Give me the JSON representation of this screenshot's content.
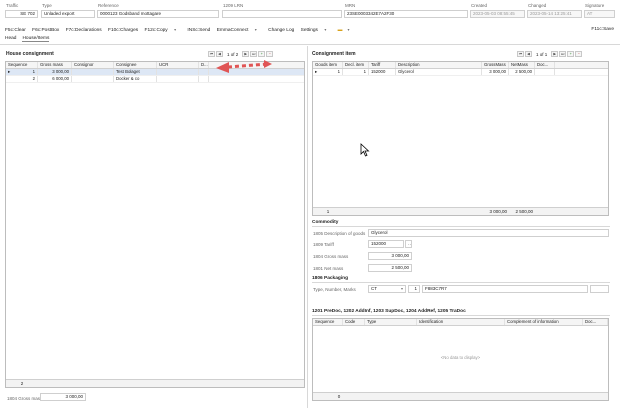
{
  "header": {
    "labels": {
      "traffic": "Traffic",
      "type": "Type",
      "reference": "Reference",
      "lrn": "1209 LRN",
      "mrn": "MRN",
      "created": "Created",
      "changed": "Changed",
      "signature": "Signature"
    },
    "values": {
      "traffic": "SE 702",
      "type": "Unladed export",
      "reference": "0000123 Godsband mottagare",
      "lrn": "",
      "mrn": "23SE0003342E7A2F30",
      "created": "2023-05-03 08:55:45",
      "changed": "2023-05-14 13:25:41",
      "signature": "AT"
    }
  },
  "toolbar": {
    "items": [
      "F5c:Clear",
      "F6c:PostBox",
      "F7c:Declarations",
      "F10c:Charges",
      "F12c:Copy",
      "INSc:Send",
      "EmmaConnect",
      "Change Log",
      "Settings"
    ],
    "save": "F11c:Save"
  },
  "tabs": [
    "Head",
    "House/Items"
  ],
  "house_consignment": {
    "title": "House consignment",
    "page_info": "1 of 2",
    "columns": [
      "Sequence",
      "Gross mass",
      "Consignor",
      "Consignee",
      "UCR",
      "D..."
    ],
    "rows": [
      {
        "sequence": "1",
        "gross_mass": "3 000,00",
        "consignor": "",
        "consignee": "Test Bolaget",
        "ucr": "",
        "d": ""
      },
      {
        "sequence": "2",
        "gross_mass": "6 000,00",
        "consignor": "",
        "consignee": "Docker & co",
        "ucr": "",
        "d": ""
      }
    ],
    "footer_count": "2",
    "gross_mass_label": "1804 Gross mass",
    "gross_mass_value": "3 000,00"
  },
  "consignment_item": {
    "title": "Consignment item",
    "page_info": "1 of 1",
    "columns": [
      "Goods item",
      "Decl. item",
      "Tariff",
      "Description",
      "GrossMass",
      "NetMass",
      "Doc..."
    ],
    "rows": [
      {
        "goods_item": "1",
        "decl_item": "1",
        "tariff": "152000",
        "description": "Glycerol",
        "gross": "3 000,00",
        "net": "2 500,00",
        "doc": ""
      }
    ],
    "footer": {
      "count": "1",
      "gross": "3 000,00",
      "net": "2 500,00"
    }
  },
  "commodity": {
    "title": "Commodity",
    "description_label": "1805 Description of goods",
    "description_value": "Glycerol",
    "tariff_label": "1809 Tariff",
    "tariff_value": "152000",
    "gross_label": "1804 Gross mass",
    "gross_value": "3 000,00",
    "net_label": "1801 Net mass",
    "net_value": "2 500,00"
  },
  "packaging": {
    "title": "1806 Packaging",
    "label": "Type, Number, Marks",
    "type": "CT",
    "number": "1",
    "marks": "F883C7R7"
  },
  "docs": {
    "title": "1201 PreDoc, 1202 AddInf, 1203 SupDoc, 1204 AddRef, 1205 TraDoc",
    "columns": [
      "Sequence",
      "Code",
      "Type",
      "Identification",
      "Complement of information",
      "Doc..."
    ],
    "empty": "<No data to display>",
    "footer_count": "0"
  },
  "colors": {
    "arrow": "#e05555",
    "selected_row": "#dde7f5"
  }
}
